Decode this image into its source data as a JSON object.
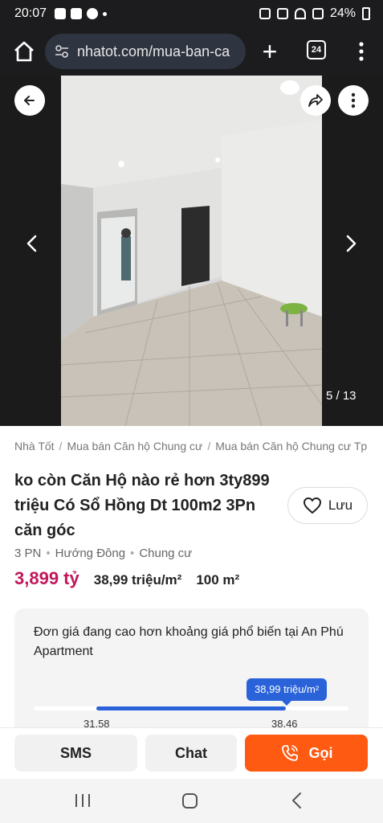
{
  "status_bar": {
    "time": "20:07",
    "battery": "24%"
  },
  "browser": {
    "url": "nhatot.com/mua-ban-ca",
    "tabs_count": "24"
  },
  "gallery": {
    "counter": "5 / 13"
  },
  "breadcrumb": [
    "Nhà Tốt",
    "Mua bán Căn hộ Chung cư",
    "Mua bán Căn hộ Chung cư Tp"
  ],
  "listing": {
    "title": "ko còn Căn Hộ nào rẻ hơn 3ty899 triệu Có Sổ Hồng Dt 100m2 3Pn căn góc",
    "save_label": "Lưu",
    "specs": [
      "3 PN",
      "Hướng Đông",
      "Chung cư"
    ],
    "price": "3,899 tỷ",
    "price_per_m2": "38,99 triệu/m²",
    "area": "100 m²"
  },
  "price_info": {
    "message": "Đơn giá đang cao hơn khoảng giá phổ biến tại An Phú Apartment",
    "tooltip": "38,99 triệu/m²",
    "range_low": "31,58",
    "range_high": "38,46"
  },
  "actions": {
    "sms": "SMS",
    "chat": "Chat",
    "call": "Gọi"
  },
  "colors": {
    "price": "#c2185b",
    "call_button": "#fe5a12",
    "range_bar": "#2962d9"
  }
}
